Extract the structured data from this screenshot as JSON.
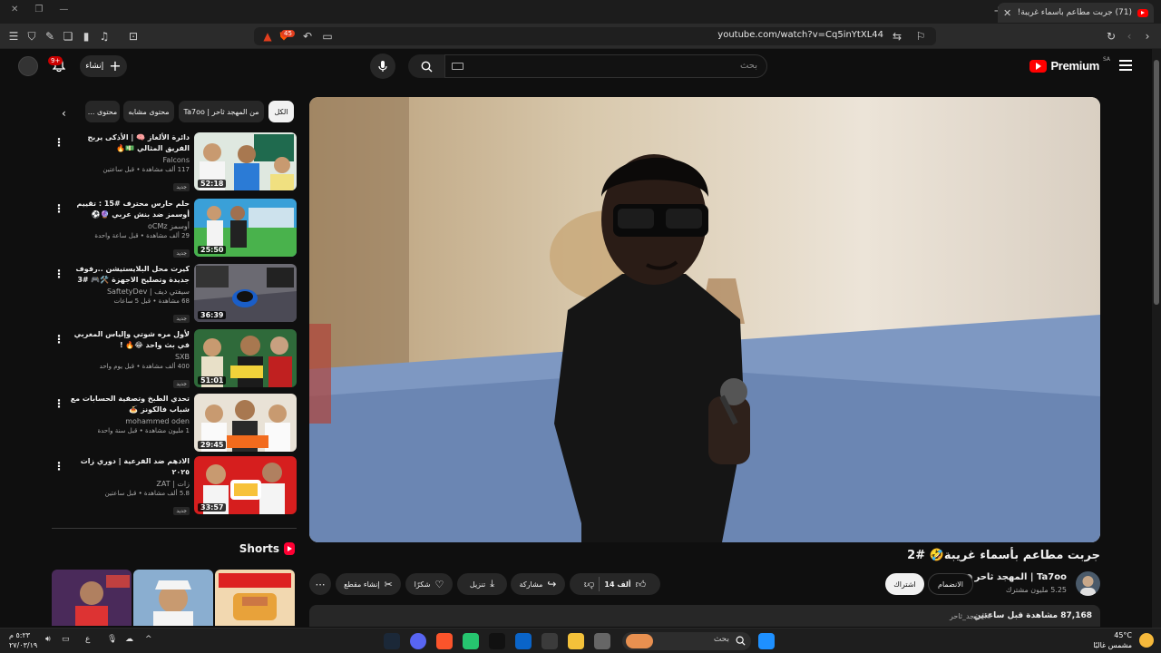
{
  "browser": {
    "tab_title": "(71) جربت مطاعم بأسماء غريبة!",
    "url": "youtube.com/watch?v=Cq5inYtXL44",
    "shield_badge": "45"
  },
  "masthead": {
    "brand": "Premium",
    "region": "SA",
    "search_placeholder": "بحث",
    "create_label": "إنشاء",
    "notification_count": "9+"
  },
  "video": {
    "title": "جربت مطاعم بأسماء غريبة🤣 #2",
    "channel": "Ta7oo | المهجد ثاحر",
    "subscribers": "5.25 مليون مشترك",
    "join_label": "الانضمام",
    "subscribe_label": "اشتراك",
    "likes": "14 ألف",
    "share_label": "مشاركة",
    "download_label": "تنزيل",
    "thanks_label": "شكرًا",
    "clip_label": "إنشاء مقطع",
    "views": "87,168 مشاهدة  قبل ساعتين",
    "hashtag": "#المهجد_ثاحر"
  },
  "chips": [
    "الكل",
    "من المهجد ثاحر | Ta7oo",
    "محتوى مشابه",
    "محتوى ..."
  ],
  "recommendations": [
    {
      "title": "دائرة الألغاز 🧠 | الأذكى يربح الفريق المثالي 💵🔥",
      "channel": "Falcons",
      "meta": "117 ألف مشاهدة • قبل ساعتين",
      "badge": "جديد",
      "duration": "52:18"
    },
    {
      "title": "حلم حارس محترف #15 : تقييم أوسمز ضد بنش عربي 🔮⚽",
      "channel": "أوسمز oCMz",
      "meta": "29 ألف مشاهدة • قبل ساعة واحدة",
      "badge": "جديد",
      "duration": "25:50"
    },
    {
      "title": "كيرت محل البلايستيشن ..رفوف جديدة وتصليح الاجهزة 🛠️🎮 #3",
      "channel": "سيفتي ديف | SaftetyDev",
      "meta": "68 مشاهدة • قبل 5 ساعات",
      "badge": "جديد",
      "duration": "36:39"
    },
    {
      "title": "لأول مره شوتي وإلياس المغربي في بث واحد 😂🔥 !",
      "channel": "SXB",
      "meta": "400 ألف مشاهدة • قبل يوم واحد",
      "badge": "جديد",
      "duration": "51:01"
    },
    {
      "title": "تحدي الطبخ وتصفية الحسابات مع شباب فالكونز 🍝",
      "channel": "mohammed oden",
      "meta": "1 مليون مشاهدة • قبل سنة واحدة",
      "badge": "",
      "duration": "29:45"
    },
    {
      "title": "الادهم ضد الفرعية | دوري زات ٢٠٢٥",
      "channel": "زات | ZAT",
      "meta": "5.8 ألف مشاهدة • قبل ساعتين",
      "badge": "جديد",
      "duration": "33:57"
    }
  ],
  "shorts_label": "Shorts",
  "taskbar": {
    "search_label": "بحث",
    "weather_temp": "45°C",
    "weather_desc": "مشمس غالبًا",
    "time": "٥:٢٣ م",
    "date": "٢٧/٠٣/١٩"
  }
}
